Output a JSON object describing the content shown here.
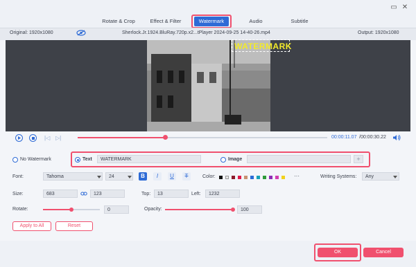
{
  "tabs": [
    {
      "label": "Rotate & Crop"
    },
    {
      "label": "Effect & Filter"
    },
    {
      "label": "Watermark"
    },
    {
      "label": "Audio"
    },
    {
      "label": "Subtitle"
    }
  ],
  "info": {
    "original": "Original: 1920x1080",
    "filename": "Sherlock.Jr.1924.BluRay.720p.x2...tPlayer 2024-09-25 14-40-26.mp4",
    "output": "Output: 1920x1080"
  },
  "preview": {
    "watermark_text": "WATERMARK"
  },
  "playback": {
    "current_time": "00:00:11.07",
    "total_time": "/00:00:30.22",
    "progress_fraction": 0.35
  },
  "watermark_type": {
    "none_label": "No Watermark",
    "text_label": "Text",
    "text_value": "WATERMARK",
    "image_label": "Image",
    "image_value": "",
    "add_icon": "+"
  },
  "font": {
    "label": "Font:",
    "family": "Tahoma",
    "size_value": "24",
    "bold": "B",
    "italic": "I",
    "underline": "U",
    "strike": "T",
    "color_label": "Color:",
    "colors": [
      "#111111",
      "#e8e8e8",
      "#8b1a2b",
      "#e0194a",
      "#c89070",
      "#2b6bd6",
      "#17a2b8",
      "#2e9a3a",
      "#8e2db5",
      "#d23fb0",
      "#f2d21c"
    ],
    "more": "···",
    "writing_label": "Writing Systems:",
    "writing_value": "Any"
  },
  "size": {
    "label": "Size:",
    "width": "683",
    "height": "123",
    "top_label": "Top:",
    "top_value": "13",
    "left_label": "Left:",
    "left_value": "1232"
  },
  "rotate": {
    "label": "Rotate:",
    "value": "0",
    "fraction": 0.5
  },
  "opacity": {
    "label": "Opacity:",
    "value": "100",
    "fraction": 1.0
  },
  "actions": {
    "apply_all": "Apply to All",
    "reset": "Reset"
  },
  "footer": {
    "ok": "OK",
    "cancel": "Cancel"
  }
}
